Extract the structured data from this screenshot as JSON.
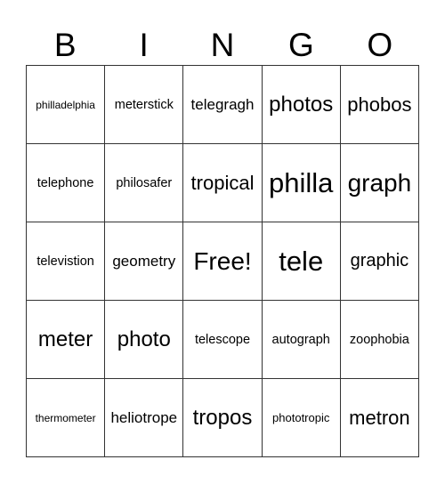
{
  "header": {
    "letters": [
      "B",
      "I",
      "N",
      "G",
      "O"
    ]
  },
  "grid": {
    "rows": [
      [
        "philladelphia",
        "meterstick",
        "telegragh",
        "photos",
        "phobos"
      ],
      [
        "telephone",
        "philosafer",
        "tropical",
        "philla",
        "graph"
      ],
      [
        "televistion",
        "geometry",
        "Free!",
        "tele",
        "graphic"
      ],
      [
        "meter",
        "photo",
        "telescope",
        "autograph",
        "zoophobia"
      ],
      [
        "thermometer",
        "heliotrope",
        "tropos",
        "phototropic",
        "metron"
      ]
    ]
  }
}
